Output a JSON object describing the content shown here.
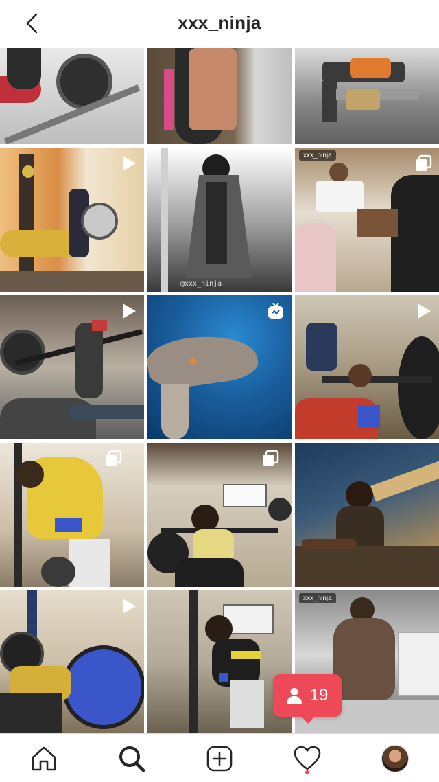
{
  "header": {
    "username": "xxx_ninja"
  },
  "grid": {
    "tiles": [
      {
        "id": "post-1",
        "kind": "photo",
        "colors": [
          "#d9d9d9",
          "#2b2b2b"
        ]
      },
      {
        "id": "post-2",
        "kind": "photo",
        "colors": [
          "#4a3d2e",
          "#cfcfcf"
        ]
      },
      {
        "id": "post-3",
        "kind": "photo",
        "colors": [
          "#6f6f6f",
          "#e07a2e"
        ]
      },
      {
        "id": "post-4",
        "kind": "video",
        "colors": [
          "#e08a3a",
          "#f4e0c0"
        ]
      },
      {
        "id": "post-5",
        "kind": "photo",
        "colors": [
          "#222222",
          "#bdbdbd"
        ],
        "watermark": "@xxx_ninja"
      },
      {
        "id": "post-6",
        "kind": "carousel",
        "colors": [
          "#8b6a4a",
          "#e8e2d8"
        ],
        "tag": "xxx_ninja"
      },
      {
        "id": "post-7",
        "kind": "video",
        "colors": [
          "#8c8478",
          "#2c2c2c"
        ]
      },
      {
        "id": "post-8",
        "kind": "igtv",
        "colors": [
          "#1f6fb0",
          "#0c3c6a"
        ]
      },
      {
        "id": "post-9",
        "kind": "video",
        "colors": [
          "#b9a992",
          "#c23b2b"
        ]
      },
      {
        "id": "post-10",
        "kind": "carousel",
        "colors": [
          "#e2d8c8",
          "#e6c83a"
        ]
      },
      {
        "id": "post-11",
        "kind": "carousel",
        "colors": [
          "#7a6650",
          "#cfc6b6"
        ]
      },
      {
        "id": "post-12",
        "kind": "photo",
        "colors": [
          "#23405e",
          "#b07a3a"
        ]
      },
      {
        "id": "post-13",
        "kind": "video",
        "colors": [
          "#cfc6b6",
          "#3a56c8"
        ]
      },
      {
        "id": "post-14",
        "kind": "carousel",
        "colors": [
          "#b4aa9a",
          "#333333"
        ]
      },
      {
        "id": "post-15",
        "kind": "photo",
        "colors": [
          "#9c9c9c",
          "#e0e0e0"
        ],
        "tag": "xxx_ninja"
      }
    ]
  },
  "notification": {
    "count": "19",
    "icon": "person-icon"
  },
  "tabbar": {
    "tabs": [
      "home-icon",
      "search-icon",
      "new-post-icon",
      "activity-icon",
      "profile-avatar"
    ],
    "accent": "#ed4956"
  }
}
